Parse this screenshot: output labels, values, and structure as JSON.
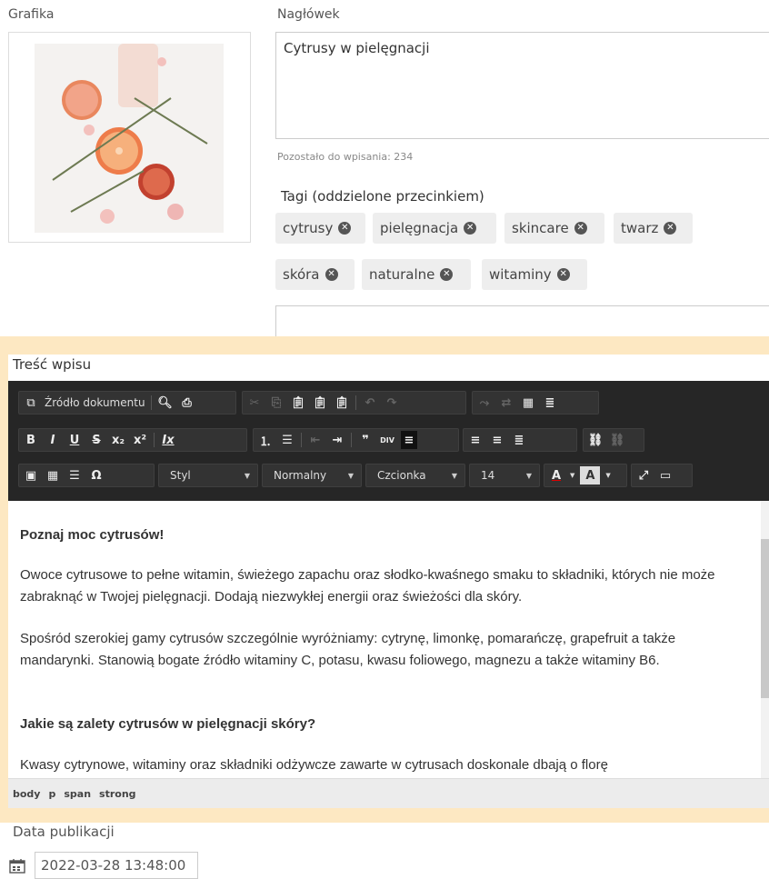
{
  "labels": {
    "image": "Grafika",
    "heading": "Nagłówek",
    "remaining": "Pozostało do wpisania: 234",
    "tags": "Tagi (oddzielone przecinkiem)",
    "content": "Treść wpisu",
    "publish_date": "Data publikacji"
  },
  "heading_value": "Cytrusy w pielęgnacji",
  "tags": [
    "cytrusy",
    "pielęgnacja",
    "skincare",
    "twarz",
    "skóra",
    "naturalne",
    "witaminy"
  ],
  "toolbar": {
    "source": "Źródło dokumentu",
    "style": "Styl",
    "format": "Normalny",
    "font": "Czcionka",
    "size": "14",
    "bold": "B",
    "italic": "I",
    "underline": "U",
    "strike": "S",
    "subscript": "x₂",
    "superscript": "x²",
    "remove_format": "Ix",
    "omega": "Ω",
    "quote": "❞",
    "div": "DIV",
    "text_color": "A",
    "bg_color": "A"
  },
  "content": {
    "heading1": "Poznaj moc cytrusów!",
    "para1": "Owoce cytrusowe to pełne witamin, świeżego zapachu oraz słodko-kwaśnego smaku to składniki, których nie może zabraknąć w Twojej pielęgnacji. Dodają niezwykłej energii oraz świeżości dla skóry.",
    "para2": "Spośród szerokiej gamy cytrusów szczególnie wyróżniamy: cytrynę, limonkę, pomarańczę, grapefruit a także mandarynki. Stanowią bogate źródło witaminy C, potasu, kwasu foliowego, magnezu a także witaminy B6.",
    "heading2": "Jakie są zalety cytrusów w pielęgnacji skóry?",
    "para3": "Kwasy cytrynowe, witaminy oraz składniki odżywcze zawarte w cytrusach doskonale dbają o florę"
  },
  "path": [
    "body",
    "p",
    "span",
    "strong"
  ],
  "publish_date": "2022-03-28 13:48:00",
  "colors": {
    "accent_bg": "#fde8c2",
    "toolbar": "#262626"
  }
}
